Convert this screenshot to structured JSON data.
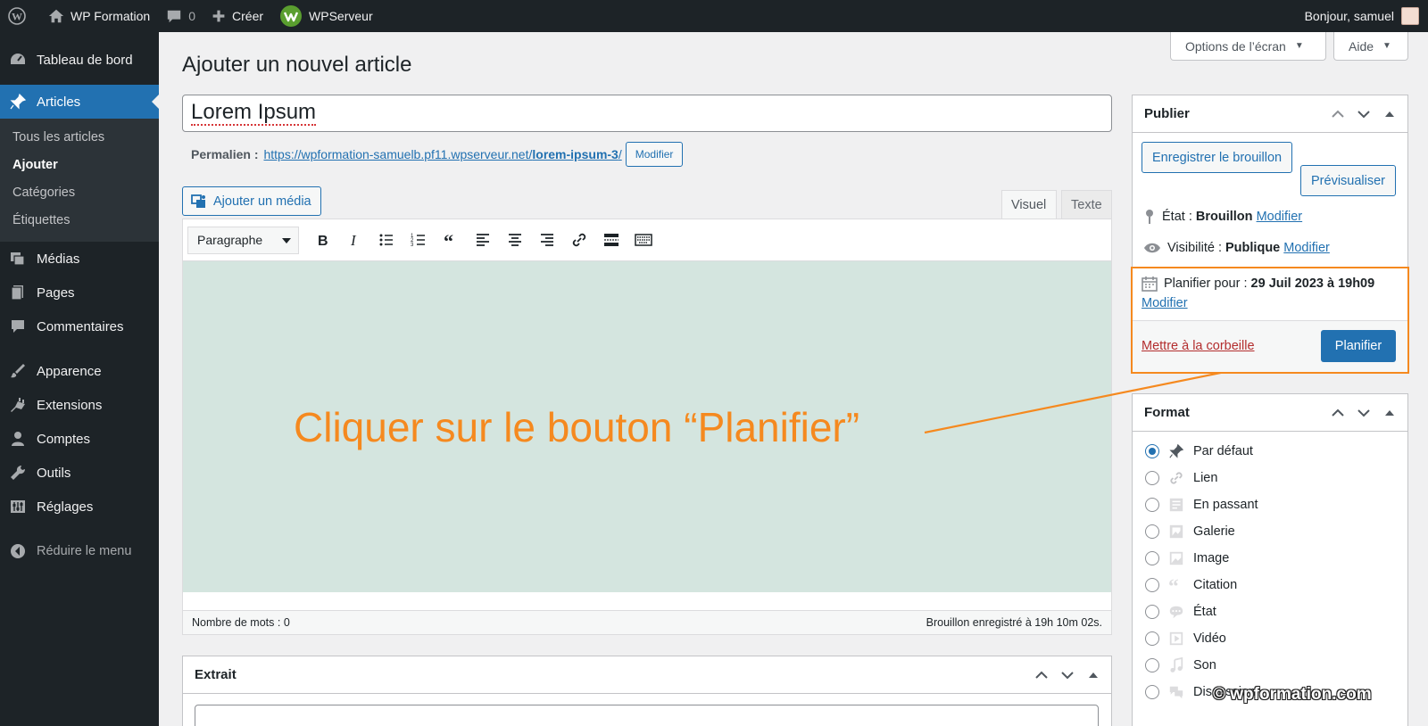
{
  "admin_bar": {
    "site_name": "WP Formation",
    "comments_count": "0",
    "new_label": "Créer",
    "host_label": "WPServeur",
    "greeting": "Bonjour, samuel"
  },
  "sidebar": {
    "dashboard": "Tableau de bord",
    "articles": "Articles",
    "submenu": [
      "Tous les articles",
      "Ajouter",
      "Catégories",
      "Étiquettes"
    ],
    "medias": "Médias",
    "pages": "Pages",
    "comments": "Commentaires",
    "appearance": "Apparence",
    "extensions": "Extensions",
    "accounts": "Comptes",
    "tools": "Outils",
    "settings": "Réglages",
    "collapse": "Réduire le menu"
  },
  "screen_options": {
    "options_label": "Options de l’écran",
    "help_label": "Aide"
  },
  "page_title": "Ajouter un nouvel article",
  "post_title": "Lorem Ipsum",
  "permalink": {
    "label": "Permalien :",
    "url_base": "https://wpformation-samuelb.pf11.wpserveur.net/",
    "slug": "lorem-ipsum-3",
    "url_end": "/",
    "edit_label": "Modifier"
  },
  "editor": {
    "add_media": "Ajouter un média",
    "tab_visual": "Visuel",
    "tab_text": "Texte",
    "format_select": "Paragraphe",
    "word_count": "Nombre de mots : 0",
    "draft_saved": "Brouillon enregistré à 19h 10m 02s."
  },
  "callout_text": "Cliquer sur le bouton “Planifier”",
  "excerpt": {
    "title": "Extrait"
  },
  "publish": {
    "title": "Publier",
    "save_draft": "Enregistrer le brouillon",
    "preview": "Prévisualiser",
    "status_label": "État :",
    "status_value": "Brouillon",
    "visibility_label": "Visibilité :",
    "visibility_value": "Publique",
    "schedule_label": "Planifier pour :",
    "schedule_value": "29 Juil 2023 à 19h09",
    "modify": "Modifier",
    "trash": "Mettre à la corbeille",
    "schedule_button": "Planifier"
  },
  "format_box": {
    "title": "Format",
    "options": [
      "Par défaut",
      "Lien",
      "En passant",
      "Galerie",
      "Image",
      "Citation",
      "État",
      "Vidéo",
      "Son",
      "Discussion"
    ],
    "selected": "Par défaut"
  },
  "watermark": "© wpformation.com",
  "colors": {
    "accent": "#2271b1",
    "callout": "#f5891f",
    "editor_bg": "#d4e5df",
    "sidebar": "#1d2327"
  }
}
